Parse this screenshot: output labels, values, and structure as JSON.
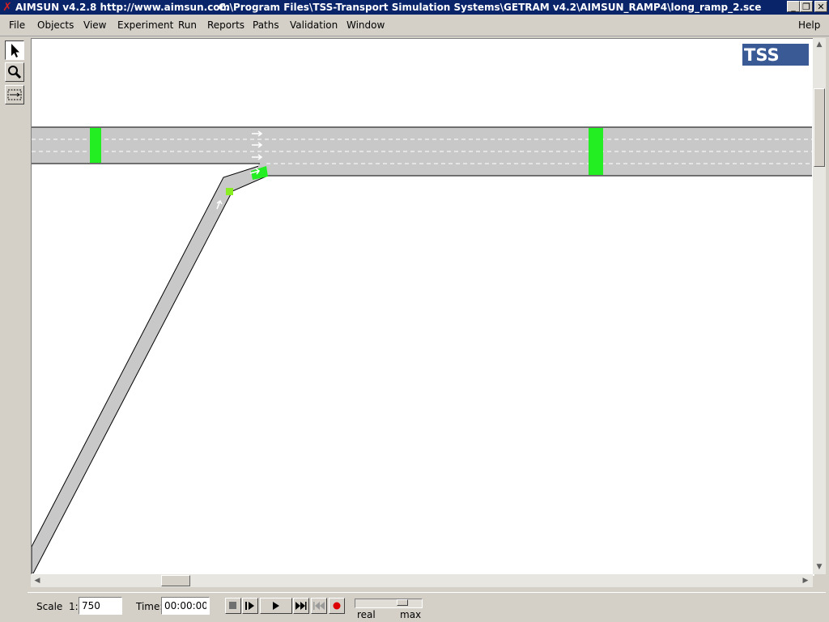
{
  "window": {
    "app_title": "AIMSUN v4.2.8 http://www.aimsun.com",
    "file_path": "C:\\Program Files\\TSS-Transport Simulation Systems\\GETRAM v4.2\\AIMSUN_RAMP4\\long_ramp_2.sce",
    "minimize": "_",
    "maximize": "❐",
    "close": "✕"
  },
  "menu": {
    "items": [
      "File",
      "Objects",
      "View",
      "Experiment",
      "Run",
      "Reports",
      "Paths",
      "Validation",
      "Window"
    ],
    "help": "Help"
  },
  "toolbar": {
    "tools": [
      "select-arrow-icon",
      "zoom-magnifier-icon",
      "zoom-window-icon"
    ],
    "active": "select-arrow-icon"
  },
  "canvas": {
    "logo": "TSS",
    "colors": {
      "road": "#c8c8c8",
      "detector": "#22ee22",
      "lane_marking": "#ffffff",
      "logo_bg": "#3a5a96"
    }
  },
  "status": {
    "scale_label": "Scale",
    "scale_prefix": "1:",
    "scale_value": "750",
    "time_label": "Time:",
    "time_value": "00:00:00",
    "speed_real": "real",
    "speed_max": "max",
    "speed_level": 0.75,
    "controls": [
      "stop-icon",
      "step-icon",
      "play-icon",
      "fast-forward-icon",
      "rewind-icon",
      "record-icon"
    ],
    "record_color": "#dd0000"
  }
}
